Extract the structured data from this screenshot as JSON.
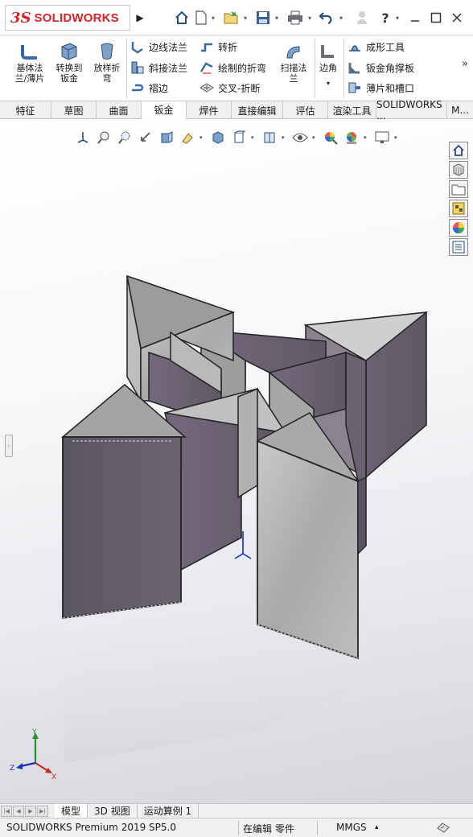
{
  "app": {
    "logo_mark": "3S",
    "logo_text": "SOLIDWORKS"
  },
  "quick_access": [
    {
      "icon": "home-icon"
    },
    {
      "icon": "new-document-icon"
    },
    {
      "icon": "open-icon"
    },
    {
      "icon": "save-icon"
    },
    {
      "icon": "print-icon"
    },
    {
      "icon": "undo-icon"
    },
    {
      "icon": "user-icon"
    },
    {
      "icon": "help-icon",
      "glyph": "?"
    }
  ],
  "ribbon": {
    "big_buttons": [
      {
        "label": "基体法\n兰/薄片",
        "icon": "base-flange-icon"
      },
      {
        "label": "转换到\n钣金",
        "icon": "convert-to-sheet-metal-icon"
      },
      {
        "label": "放样折\n弯",
        "icon": "lofted-bend-icon"
      }
    ],
    "small_col1": [
      {
        "label": "边线法兰",
        "icon": "edge-flange-icon"
      },
      {
        "label": "斜接法兰",
        "icon": "miter-flange-icon"
      },
      {
        "label": "褶边",
        "icon": "hem-icon"
      }
    ],
    "small_col2": [
      {
        "label": "转折",
        "icon": "jog-icon"
      },
      {
        "label": "绘制的折弯",
        "icon": "sketched-bend-icon"
      },
      {
        "label": "交叉-折断",
        "icon": "cross-break-icon"
      }
    ],
    "sweep_button": {
      "label": "扫描法\n兰",
      "icon": "swept-flange-icon"
    },
    "corner_button": {
      "label": "边角",
      "icon": "corner-icon"
    },
    "small_col3": [
      {
        "label": "成形工具",
        "icon": "forming-tool-icon"
      },
      {
        "label": "钣金角撑板",
        "icon": "sheet-metal-gusset-icon"
      },
      {
        "label": "薄片和槽口",
        "icon": "tab-and-slot-icon"
      }
    ]
  },
  "tabs": [
    {
      "label": "特征"
    },
    {
      "label": "草图"
    },
    {
      "label": "曲面"
    },
    {
      "label": "钣金",
      "active": true
    },
    {
      "label": "焊件"
    },
    {
      "label": "直接编辑"
    },
    {
      "label": "评估"
    },
    {
      "label": "渲染工具"
    },
    {
      "label": "SOLIDWORKS ..."
    },
    {
      "label": "M..."
    }
  ],
  "heads_up_toolbar": [
    "view-orientation-icon",
    "zoom-to-fit-icon",
    "zoom-to-area-icon",
    "previous-view-icon",
    "section-view-icon",
    "dynamic-annotation-icon",
    "display-style-icon",
    "hide-show-icon",
    "edit-appearance-icon",
    "apply-scene-icon",
    "view-settings-icon"
  ],
  "task_pane": [
    "solidworks-resources-icon",
    "design-library-icon",
    "file-explorer-icon",
    "view-palette-icon",
    "appearances-icon",
    "custom-properties-icon"
  ],
  "triad": {
    "x": "X",
    "y": "Y",
    "z": "Z"
  },
  "bottom_tabs": [
    {
      "label": "模型",
      "active": true
    },
    {
      "label": "3D 视图"
    },
    {
      "label": "运动算例 1"
    }
  ],
  "status": {
    "product": "SOLIDWORKS Premium 2019 SP5.0",
    "mode": "在编辑 零件",
    "units": "MMGS"
  },
  "colors": {
    "brand": "#d2232a",
    "metal_face": "#b3b3b5",
    "metal_dark": "#5d5962",
    "metal_purple": "#6e6374",
    "accent_blue": "#2a4e7c"
  }
}
